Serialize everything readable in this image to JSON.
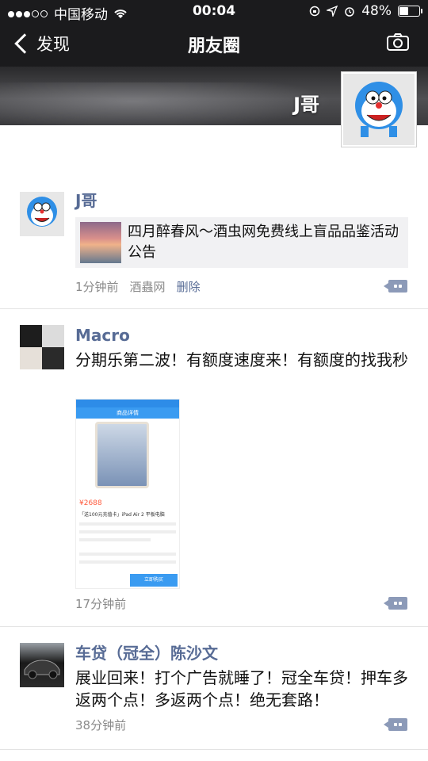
{
  "status_bar": {
    "carrier": "中国移动",
    "time": "00:04",
    "battery": "48%"
  },
  "nav": {
    "back_label": "发现",
    "title": "朋友圈"
  },
  "cover": {
    "name": "J哥"
  },
  "posts": [
    {
      "name": "J哥",
      "link_title": "四月醉春风～酒虫网免费线上盲品品鉴活动公告",
      "time": "1分钟前",
      "source": "酒蟲网",
      "delete_label": "删除"
    },
    {
      "name": "Macro",
      "text": "分期乐第二波！有额度速度来！有额度的找我秒",
      "time": "17分钟前",
      "image": {
        "header": "商品详情",
        "price": "¥2688",
        "product": "「送100元充值卡」iPad Air 2 平板电脑",
        "buy_label": "立即购买"
      }
    },
    {
      "name": "车贷（冠全）陈沙文",
      "text": "展业回来！打个广告就睡了！冠全车贷！押车多返两个点！多返两个点！绝无套路！",
      "time": "38分钟前"
    }
  ],
  "colors": {
    "link_name": "#576b95",
    "meta_gray": "#8a8a8a",
    "cover_dark": "#1b1b1d"
  }
}
